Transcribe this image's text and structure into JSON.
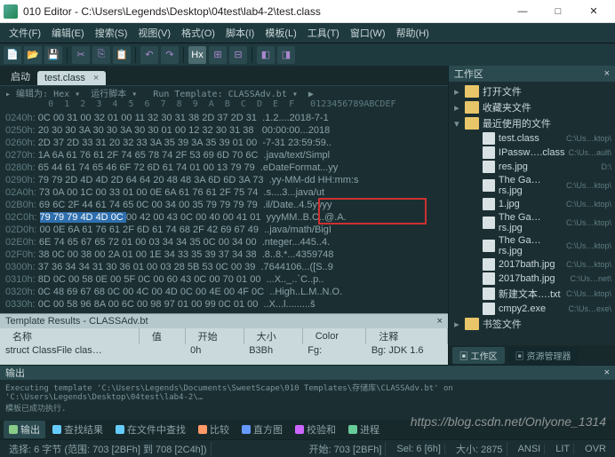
{
  "window": {
    "title": "010 Editor - C:\\Users\\Legends\\Desktop\\04test\\lab4-2\\test.class",
    "min": "—",
    "max": "□",
    "close": "✕"
  },
  "menu": [
    "文件(F)",
    "编辑(E)",
    "搜索(S)",
    "视图(V)",
    "格式(O)",
    "脚本(I)",
    "模板(L)",
    "工具(T)",
    "窗口(W)",
    "帮助(H)"
  ],
  "tabs": {
    "start": "启动",
    "file": "test.class",
    "x": "×"
  },
  "hex": {
    "header": "▸ 编辑为: Hex ▾  运行脚本 ▾   Run Template: CLASSAdv.bt ▾  ▶",
    "cols": "        0  1  2  3  4  5  6  7  8  9  A  B  C  D  E  F   0123456789ABCDEF",
    "rows": [
      {
        "a": "0240h:",
        "h": "0C 00 31 00 32 01 00 11 32 30 31 38 2D 37 2D 31 ",
        ".": ".1.2....2018-7-1"
      },
      {
        "a": "0250h:",
        "h": "20 30 30 3A 30 30 3A 30 30 01 00 12 32 30 31 38 ",
        ".": " 00:00:00...2018"
      },
      {
        "a": "0260h:",
        "h": "2D 37 2D 33 31 20 32 33 3A 35 39 3A 35 39 01 00 ",
        ".": "-7-31 23:59:59.."
      },
      {
        "a": "0270h:",
        "h": "1A 6A 61 76 61 2F 74 65 78 74 2F 53 69 6D 70 6C ",
        ".": ".java/text/Simpl"
      },
      {
        "a": "0280h:",
        "h": "65 44 61 74 65 46 6F 72 6D 61 74 01 00 13 79 79 ",
        ".": ".eDateFormat...yy"
      },
      {
        "a": "0290h:",
        "h": "79 79 2D 4D 4D 2D 64 64 20 48 48 3A 6D 6D 3A 73 ",
        ".": ".yy-MM-dd HH:mm:s"
      },
      {
        "a": "02A0h:",
        "h": "73 0A 00 1C 00 33 01 00 0E 6A 61 76 61 2F 75 74 ",
        ".": ".s....3...java/ut"
      },
      {
        "a": "02B0h:",
        "h": "69 6C 2F 44 61 74 65 0C 00 34 00 35 79 79 79 79 ",
        ".": ".il/Date..4.5yyyy",
        "box": true
      },
      {
        "a": "02C0h:",
        "h": "79 79 79 4D 4D 0C 00 42 00 43 0C 00 40 00 41 01 ",
        ".": "yyyMM..B.C..@.A.",
        "sel": [
          0,
          6
        ],
        "box": true
      },
      {
        "a": "02D0h:",
        "h": "00 0E 6A 61 76 61 2F 6D 61 74 68 2F 42 69 67 49 ",
        ".": "..java/math/BigI"
      },
      {
        "a": "02E0h:",
        "h": "6E 74 65 67 65 72 01 00 03 34 34 35 0C 00 34 00 ",
        ".": ".nteger...445..4."
      },
      {
        "a": "02F0h:",
        "h": "38 0C 00 38 00 2A 01 00 1E 34 33 35 39 37 34 38 ",
        ".": ".8..8.*...4359748"
      },
      {
        "a": "0300h:",
        "h": "37 36 34 34 31 30 36 01 00 03 28 5B 53 0C 00 39 ",
        ".": ".7644106...([S..9"
      },
      {
        "a": "0310h:",
        "h": "8D 0C 00 58 0E 00 5F 0C 00 60 43 0C 00 70 01 00 ",
        ".": "...X.._..`C..p.."
      },
      {
        "a": "0320h:",
        "h": "0C 48 69 67 68 0C 00 4C 00 4D 0C 00 4E 00 4F 0C ",
        ".": "..High..L.M..N.O."
      },
      {
        "a": "0330h:",
        "h": "0C 00 58 96 8A 00 6C 00 98 97 01 00 99 0C 01 00 ",
        ".": "..X...l.........š"
      }
    ]
  },
  "template": {
    "title": "Template Results - CLASSAdv.bt",
    "cols": [
      "名称",
      "值",
      "开始",
      "大小",
      "Color",
      "注释"
    ],
    "row": [
      "struct ClassFile clas…",
      "",
      "0h",
      "B3Bh",
      "Fg:",
      "Bg: JDK 1.6"
    ]
  },
  "workspace": {
    "title": "工作区",
    "nodes": [
      {
        "t": "打开文件",
        "k": "fold",
        "tw": "▸"
      },
      {
        "t": "收藏夹文件",
        "k": "fold",
        "tw": "▸"
      },
      {
        "t": "最近使用的文件",
        "k": "fold",
        "tw": "▾"
      },
      {
        "t": "test.class",
        "k": "file",
        "p": "C:\\Us…ktop\\",
        "i": true
      },
      {
        "t": "IPassw….class",
        "k": "file",
        "p": "C:\\Us…ault\\",
        "i": true
      },
      {
        "t": "res.jpg",
        "k": "file",
        "p": "D:\\",
        "i": true
      },
      {
        "t": "The Ga…rs.jpg",
        "k": "file",
        "p": "C:\\Us…ktop\\",
        "i": true
      },
      {
        "t": "1.jpg",
        "k": "file",
        "p": "C:\\Us…ktop\\",
        "i": true
      },
      {
        "t": "The Ga…rs.jpg",
        "k": "file",
        "p": "C:\\Us…ktop\\",
        "i": true
      },
      {
        "t": "The Ga…rs.jpg",
        "k": "file",
        "p": "C:\\Us…ktop\\",
        "i": true
      },
      {
        "t": "2017bath.jpg",
        "k": "file",
        "p": "C:\\Us…ktop\\",
        "i": true
      },
      {
        "t": "2017bath.jpg",
        "k": "file",
        "p": "C:\\Us…net\\",
        "i": true
      },
      {
        "t": "新建文本….txt",
        "k": "file",
        "p": "C:\\Us…ktop\\",
        "i": true
      },
      {
        "t": "cmpy2.exe",
        "k": "file",
        "p": "C:\\Us…exe\\",
        "i": true
      },
      {
        "t": "书签文件",
        "k": "fold",
        "tw": "▸"
      }
    ],
    "tabs": [
      "工作区",
      "资源管理器"
    ]
  },
  "output": {
    "title": "输出",
    "text": "Executing template 'C:\\Users\\Legends\\Documents\\SweetScape\\010 Templates\\存储库\\CLASSAdv.bt' on 'C:\\Users\\Legends\\Desktop\\04test\\lab4-2\\…\n模板已成功执行."
  },
  "bottom_tabs": [
    "输出",
    "查找结果",
    "在文件中查找",
    "比较",
    "直方图",
    "校验和",
    "进程"
  ],
  "status": {
    "sel": "选择: 6 字节 (范围: 703 [2BFh] 到 708 [2C4h])",
    "pos": "开始: 703 [2BFh]",
    "selc": "Sel: 6 [6h]",
    "size": "大小: 2875",
    "enc": "ANSI",
    "end": "LIT",
    "mode": "OVR"
  },
  "watermark": "https://blog.csdn.net/Onlyone_1314"
}
